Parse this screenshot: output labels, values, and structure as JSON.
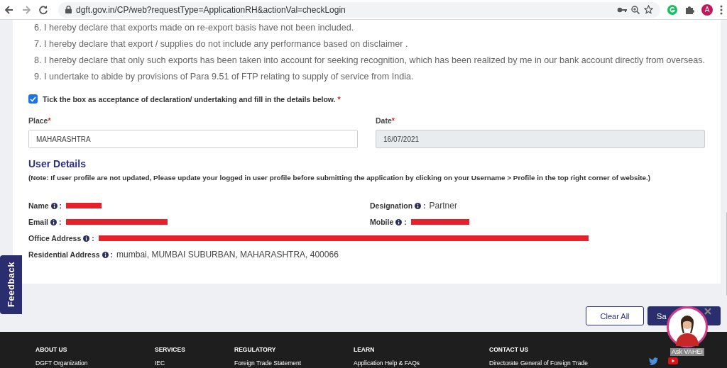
{
  "browser": {
    "url": "dgft.gov.in/CP/web?requestType=ApplicationRH&actionVal=checkLogin",
    "profile_initial": "A"
  },
  "declarations": [
    "6. I hereby declare that exports made on re-export basis have not been included.",
    "7. I hereby declare that export / supplies do not include any performance based on disclaimer .",
    "8. I hereby declare that only such exports has been taken into account for seeking recognition, which has been realized by me in our bank account directly from overseas.",
    "9. I undertake to abide by provisions of Para 9.51 of FTP relating to supply of service from India."
  ],
  "acceptance": {
    "label": "Tick the box as acceptance of declaration/ undertaking and fill in the details below.",
    "required_mark": "*",
    "checked": true
  },
  "fields": [
    {
      "label": "Place",
      "required_mark": "*",
      "value": "MAHARASHTRA",
      "disabled": false
    },
    {
      "label": "Date",
      "required_mark": "*",
      "value": "16/07/2021",
      "disabled": true
    }
  ],
  "user_details": {
    "title": "User Details",
    "note": "(Note: If user profile are not updated, Please update your logged in user profile before submitting the application by clicking on your Username > Profile in the top right corner of website.)",
    "rows": [
      {
        "items": [
          {
            "label": "Name",
            "separator": ":",
            "redacted": true
          },
          {
            "label": "Designation",
            "separator": ":",
            "value": "Partner",
            "redacted": false
          }
        ]
      },
      {
        "items": [
          {
            "label": "Email",
            "separator": ":",
            "redacted": true
          },
          {
            "label": "Mobile",
            "separator": ":",
            "redacted": true
          }
        ]
      },
      {
        "items": [
          {
            "label": "Office Address",
            "separator": ":",
            "redacted": true
          }
        ]
      },
      {
        "items": [
          {
            "label": "Residential Address",
            "separator": ":",
            "value": "mumbai, MUMBAI SUBURBAN, MAHARASHTRA, 400066",
            "redacted": false
          }
        ]
      }
    ]
  },
  "buttons": [
    {
      "label": "Clear All",
      "kind": "outline"
    },
    {
      "label": "Sa",
      "kind": "primary"
    }
  ],
  "feedback": "Feedback",
  "chat": {
    "label": "Ask VAHEI"
  },
  "footer": [
    {
      "heading": "ABOUT US",
      "links": [
        "DGFT Organization"
      ]
    },
    {
      "heading": "SERVICES",
      "links": [
        "IEC"
      ]
    },
    {
      "heading": "REGULATORY",
      "links": [
        "Foreign Trade Statement"
      ]
    },
    {
      "heading": "LEARN",
      "links": [
        "Application Help & FAQs"
      ]
    },
    {
      "heading": "CONTACT US",
      "links": [
        "Directorate General of Foreign Trade"
      ]
    }
  ]
}
